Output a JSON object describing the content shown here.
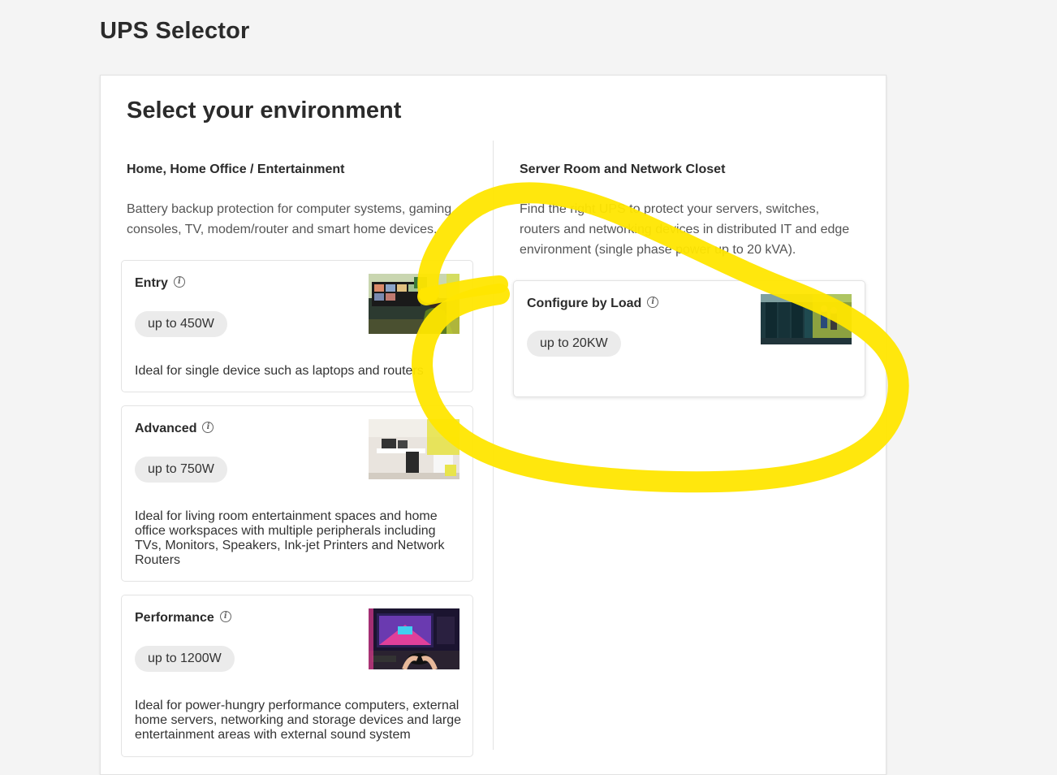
{
  "page": {
    "title": "UPS Selector"
  },
  "section": {
    "title": "Select your environment"
  },
  "home": {
    "heading": "Home, Home Office / Entertainment",
    "description": "Battery backup protection for computer systems, gaming consoles, TV, modem/router and smart home devices.",
    "cards": [
      {
        "title": "Entry",
        "pill": "up to 450W",
        "description": "Ideal for single device such as laptops and routers",
        "image": "monitor-workspace-photo"
      },
      {
        "title": "Advanced",
        "pill": "up to 750W",
        "description": "Ideal for living room entertainment spaces and home office workspaces with multiple peripherals including TVs, Monitors, Speakers, Ink-jet Printers and Network Routers",
        "image": "home-office-photo"
      },
      {
        "title": "Performance",
        "pill": "up to 1200W",
        "description": "Ideal for power-hungry performance computers, external home servers, networking and storage devices and large entertainment areas with external sound system",
        "image": "gaming-setup-photo"
      }
    ]
  },
  "server": {
    "heading": "Server Room and Network Closet",
    "description": "Find the right UPS to protect your servers, switches, routers and networking devices in distributed IT and edge environment (single phase power up to 20 kVA).",
    "cards": [
      {
        "title": "Configure by Load",
        "pill": "up to 20KW",
        "image": "server-room-photo"
      }
    ]
  },
  "icons": {
    "info": "info-icon"
  },
  "colors": {
    "highlight": "#ffe600",
    "pill_bg": "#ebebeb",
    "page_bg": "#f4f4f4"
  }
}
